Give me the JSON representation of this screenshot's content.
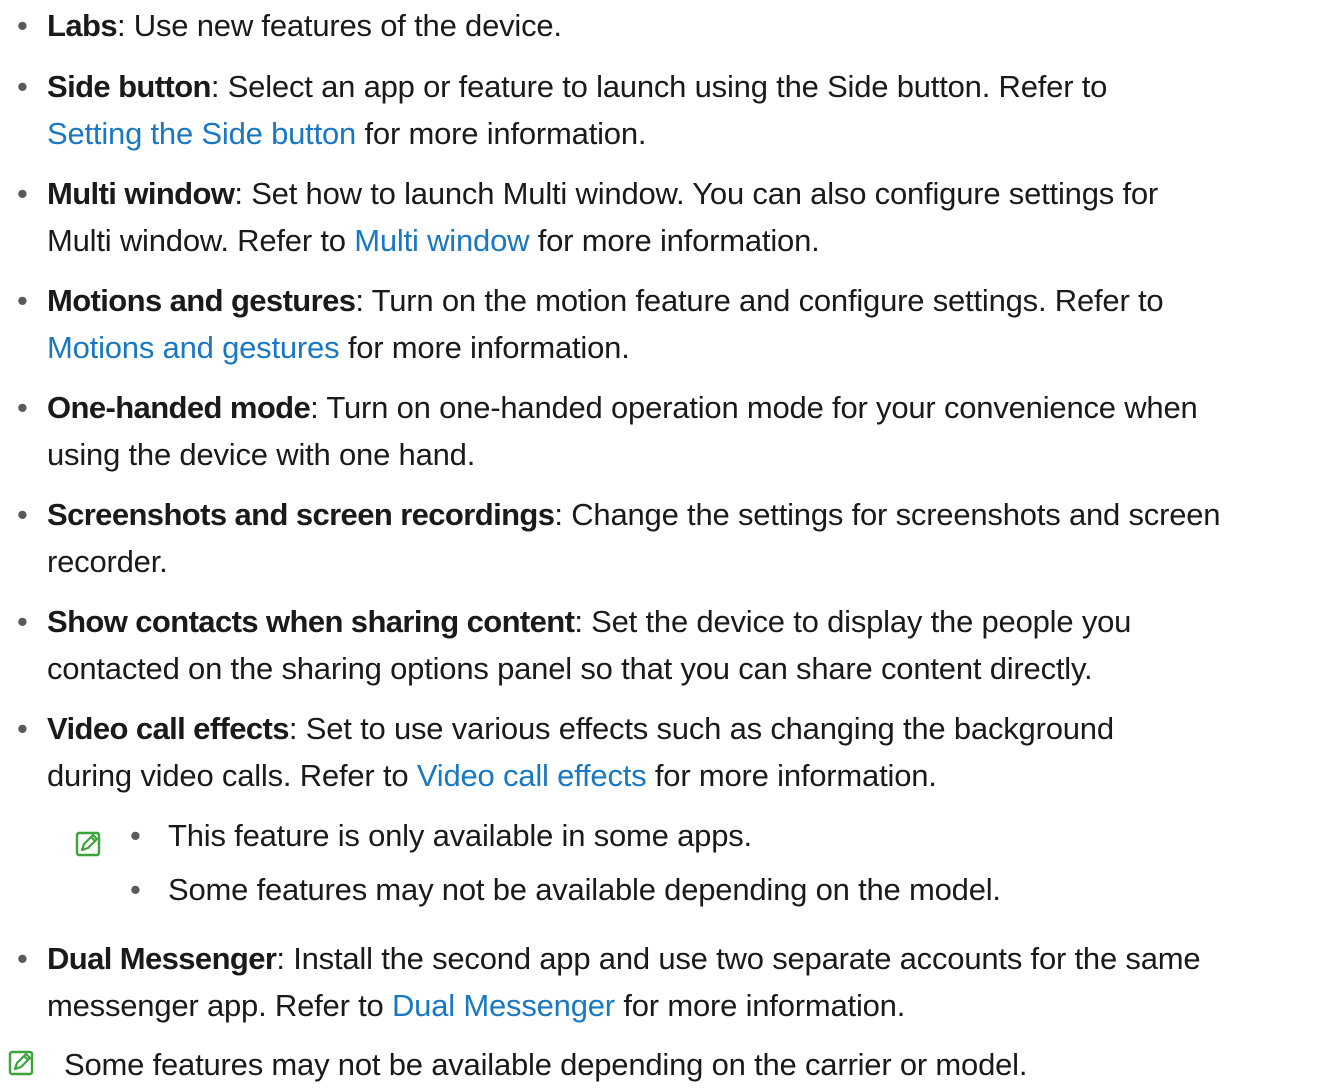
{
  "items": [
    {
      "term": "Labs",
      "sep": ":",
      "text": " Use new features of the device."
    },
    {
      "term": "Side button",
      "sep": ":",
      "text": " Select an app or feature to launch using the Side button. Refer to ",
      "link": "Setting the Side button",
      "after": " for more information."
    },
    {
      "term": "Multi window",
      "sep": ":",
      "text": " Set how to launch Multi window. You can also configure settings for Multi window. Refer to ",
      "link": "Multi window",
      "after": " for more information."
    },
    {
      "term": "Motions and gestures",
      "sep": ":",
      "text": " Turn on the motion feature and configure settings. Refer to ",
      "link": "Motions and gestures",
      "after": " for more information."
    },
    {
      "term": "One-handed mode",
      "sep": ":",
      "text": " Turn on one-handed operation mode for your convenience when using the device with one hand."
    },
    {
      "term": "Screenshots and screen recordings",
      "sep": ":",
      "text": " Change the settings for screenshots and screen recorder."
    },
    {
      "term": "Show contacts when sharing content",
      "sep": ":",
      "text": " Set the device to display the people you contacted on the sharing options panel so that you can share content directly."
    },
    {
      "term": "Video call effects",
      "sep": ":",
      "text": " Set to use various effects such as changing the background during video calls. Refer to ",
      "link": "Video call effects",
      "after": " for more information."
    },
    {
      "term": "Dual Messenger",
      "sep": ":",
      "text": " Install the second app and use two separate accounts for the same messenger app. Refer to ",
      "link": "Dual Messenger",
      "after": " for more information."
    }
  ],
  "video_notes": [
    "This feature is only available in some apps.",
    "Some features may not be available depending on the model."
  ],
  "footer_note": "Some features may not be available depending on the carrier or model.",
  "bullet_char": "•",
  "icon": "note-icon",
  "colors": {
    "link": "#1a78c2",
    "note_icon": "#3aa33a",
    "text": "#1a1a1a"
  }
}
